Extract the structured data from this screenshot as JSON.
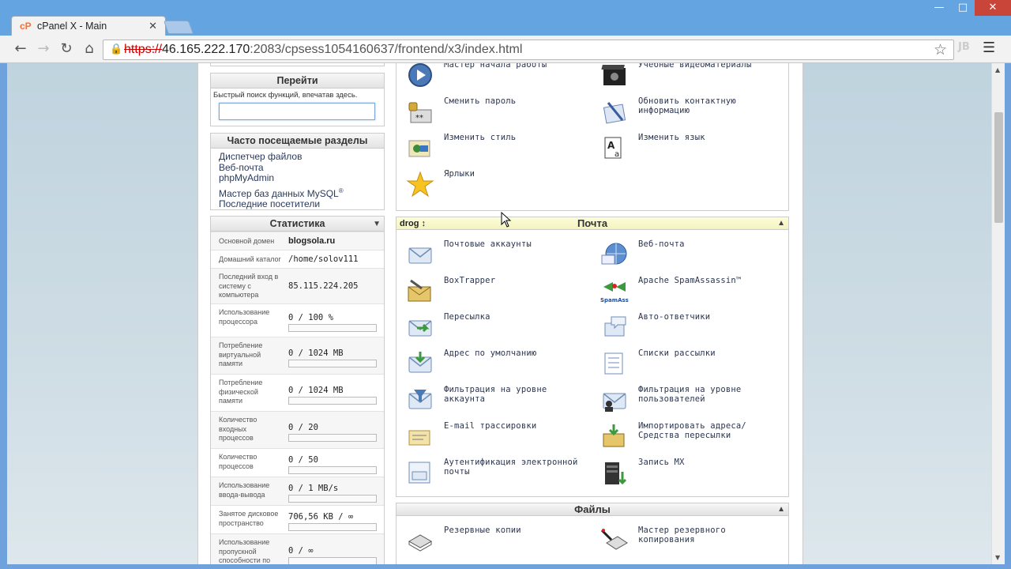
{
  "browser": {
    "tab_title": "cPanel X - Main",
    "tab_favicon": "cP",
    "url_scheme": "https://",
    "url_host": "46.165.222.170",
    "url_rest": ":2083/cpsess1054160637/frontend/x3/index.html",
    "ext_badge": "JB"
  },
  "goto": {
    "title": "Перейти",
    "hint": "Быстрый поиск функций, впечатав здесь.",
    "search_value": ""
  },
  "favorites": {
    "title": "Часто посещаемые разделы",
    "links": [
      "Диспетчер файлов",
      "Веб-почта",
      "phpMyAdmin",
      "Мастер баз данных MySQL",
      "Последние посетители"
    ],
    "registered_mark": "®"
  },
  "stats": {
    "title": "Статистика",
    "rows": [
      {
        "label": "Основной домен",
        "value": "blogsola.ru"
      },
      {
        "label": "Домашний каталог",
        "value": "/home/solov111"
      },
      {
        "label": "Последний вход в систему с компьютера",
        "value": "85.115.224.205"
      },
      {
        "label": "Использование процессора",
        "value": "0 / 100 %",
        "usage": 0
      },
      {
        "label": "Потребление виртуальной памяти",
        "value": "0 / 1024 MB",
        "usage": 0
      },
      {
        "label": "Потребление физической памяти",
        "value": "0 / 1024 MB",
        "usage": 0
      },
      {
        "label": "Количество входных процессов",
        "value": "0 / 20",
        "usage": 0
      },
      {
        "label": "Количество процессов",
        "value": "0 / 50",
        "usage": 0
      },
      {
        "label": "Использование ввода-вывода",
        "value": "0 / 1 MB/s",
        "usage": 0
      },
      {
        "label": "Занятое дисковое пространство",
        "value": "706,56 KB / ∞",
        "usage": 0
      },
      {
        "label": "Использование пропускной способности по месяцу",
        "value": "0 / ∞",
        "usage": 0
      }
    ]
  },
  "preferences": {
    "items": [
      {
        "label": "Мастер начала работы",
        "icon": "play-icon"
      },
      {
        "label": "Учебные видеоматериалы",
        "icon": "video-icon"
      },
      {
        "label": "Сменить пароль",
        "icon": "password-icon"
      },
      {
        "label": "Обновить контактную информацию",
        "icon": "contact-icon"
      },
      {
        "label": "Изменить стиль",
        "icon": "style-icon"
      },
      {
        "label": "Изменить язык",
        "icon": "language-icon"
      },
      {
        "label": "Ярлыки",
        "icon": "star-icon"
      }
    ]
  },
  "mail": {
    "title": "Почта",
    "drag_label": "drog ↕",
    "items": [
      {
        "label": "Почтовые аккаунты",
        "icon": "envelope-icon"
      },
      {
        "label": "Веб-почта",
        "icon": "webmail-globe-icon"
      },
      {
        "label": "BoxTrapper",
        "icon": "boxtrapper-icon"
      },
      {
        "label": "Apache SpamAssassin™",
        "icon": "spamassassin-icon"
      },
      {
        "label": "Пересылка",
        "icon": "forward-icon"
      },
      {
        "label": "Авто-ответчики",
        "icon": "autoresponder-icon"
      },
      {
        "label": "Адрес по умолчанию",
        "icon": "default-address-icon"
      },
      {
        "label": "Списки рассылки",
        "icon": "mailing-list-icon"
      },
      {
        "label": "Фильтрация на уровне аккаунта",
        "icon": "account-filter-icon"
      },
      {
        "label": "Фильтрация на уровне пользователей",
        "icon": "user-filter-icon"
      },
      {
        "label": "E-mail трассировки",
        "icon": "trace-icon"
      },
      {
        "label": "Импортировать адреса/ Средства пересылки",
        "icon": "import-icon"
      },
      {
        "label": "Аутентификация электронной почты",
        "icon": "auth-icon"
      },
      {
        "label": "Запись MX",
        "icon": "mx-icon"
      }
    ],
    "spamassassin_logo": "SpamAssassin"
  },
  "files": {
    "title": "Файлы",
    "items": [
      {
        "label": "Резервные копии",
        "icon": "backup-icon"
      },
      {
        "label": "Мастер резервного копирования",
        "icon": "backup-wizard-icon"
      }
    ]
  },
  "colors": {
    "window_frame": "#64a4e0",
    "close_button": "#c9453a",
    "mail_header": "#f3f3c0",
    "link": "#2a3a5c"
  }
}
